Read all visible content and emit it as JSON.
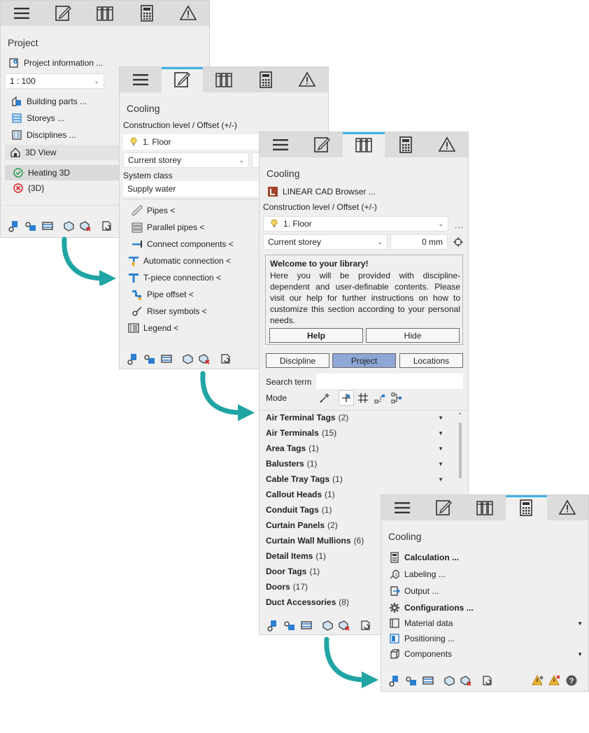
{
  "colors": {
    "accent": "#3fb3e6",
    "teal": "#20a5a4",
    "selected": "#8fa7d6"
  },
  "tabs": [
    "menu-icon",
    "edit-icon",
    "library-icon",
    "calculator-icon",
    "warning-icon"
  ],
  "panel1": {
    "section": "Project",
    "project_info": "Project information ...",
    "scale": "1 : 100",
    "items": [
      "Building parts ...",
      "Storeys ...",
      "Disciplines ..."
    ],
    "view3d": "3D View",
    "views": [
      "Heating 3D",
      "{3D}"
    ]
  },
  "panel2": {
    "section": "Cooling",
    "construction_label": "Construction level / Offset (+/-)",
    "floor": "1. Floor",
    "storey": "Current storey",
    "system_class_label": "System class",
    "system_class": "Supply water",
    "tools": [
      "Pipes <",
      "Parallel pipes <",
      "Connect components <",
      "Automatic connection <",
      "T-piece connection <",
      "Pipe offset <",
      "Riser symbols <",
      "Legend <"
    ]
  },
  "panel3": {
    "section": "Cooling",
    "browser": "LINEAR CAD Browser ...",
    "construction_label": "Construction level / Offset (+/-)",
    "floor": "1. Floor",
    "dots": "...",
    "storey": "Current storey",
    "offset": "0 mm",
    "welcome_title": "Welcome to your library!",
    "welcome_text": "Here you will be provided with discipline-dependent and user-definable contents. Please visit our help for further instructions on how to customize this section according to your personal needs.",
    "help_btn": "Help",
    "hide_btn": "Hide",
    "scope_tabs": [
      "Discipline",
      "Project",
      "Locations"
    ],
    "search_label": "Search term",
    "search_value": "",
    "mode_label": "Mode",
    "categories": [
      {
        "name": "Air Terminal Tags",
        "count": "(2)"
      },
      {
        "name": "Air Terminals",
        "count": "(15)"
      },
      {
        "name": "Area Tags",
        "count": "(1)"
      },
      {
        "name": "Balusters",
        "count": "(1)"
      },
      {
        "name": "Cable Tray Tags",
        "count": "(1)"
      },
      {
        "name": "Callout Heads",
        "count": "(1)"
      },
      {
        "name": "Conduit Tags",
        "count": "(1)"
      },
      {
        "name": "Curtain Panels",
        "count": "(2)"
      },
      {
        "name": "Curtain Wall Mullions",
        "count": "(6)"
      },
      {
        "name": "Detail Items",
        "count": "(1)"
      },
      {
        "name": "Door Tags",
        "count": "(1)"
      },
      {
        "name": "Doors",
        "count": "(17)"
      },
      {
        "name": "Duct Accessories",
        "count": "(8)"
      }
    ]
  },
  "panel4": {
    "section": "Cooling",
    "items": [
      "Calculation ...",
      "Labeling ...",
      "Output ...",
      "Configurations ...",
      "Material data",
      "Positioning ...",
      "Components"
    ]
  }
}
